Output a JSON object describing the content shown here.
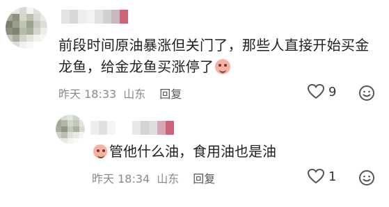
{
  "main_comment": {
    "text": "前段时间原油暴涨但关门了，那些人直接开始买金龙鱼，给金龙鱼买涨停了",
    "time": "昨天 18:33",
    "location": "山东",
    "reply_label": "回复",
    "likes": "9"
  },
  "reply_comment": {
    "text": "管他什么油，食用油也是油",
    "time": "昨天 18:34",
    "location": "山东",
    "reply_label": "回复",
    "likes": "1"
  },
  "icons": {
    "like": "heart-outline-icon",
    "react": "smile-icon",
    "emoji_main": "pig-laugh-icon",
    "emoji_reply": "pig-face-icon"
  }
}
